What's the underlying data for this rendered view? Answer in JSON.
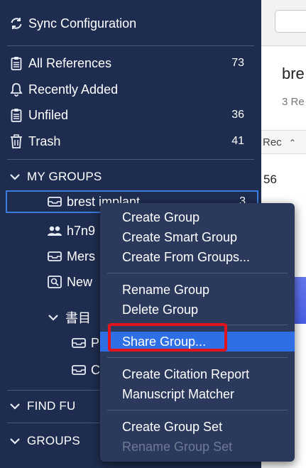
{
  "sidebar": {
    "sync": "Sync Configuration",
    "library": [
      {
        "label": "All References",
        "count": "73"
      },
      {
        "label": "Recently Added",
        "count": ""
      },
      {
        "label": "Unfiled",
        "count": "36"
      },
      {
        "label": "Trash",
        "count": "41"
      }
    ],
    "my_groups": "MY GROUPS",
    "groups": [
      {
        "label": "brest implant",
        "count": "3"
      },
      {
        "label": "h7n9",
        "count": ""
      },
      {
        "label": "Mers",
        "count": ""
      },
      {
        "label": "New",
        "count": ""
      }
    ],
    "group_set": "書目",
    "group_set_items": [
      "P",
      "C"
    ],
    "find_full_text": "FIND FU",
    "groups_section": "GROUPS"
  },
  "context_menu": {
    "items": [
      {
        "label": "Create Group",
        "enabled": true
      },
      {
        "label": "Create Smart Group",
        "enabled": true
      },
      {
        "label": "Create From Groups...",
        "enabled": true
      },
      {
        "label": "Rename Group",
        "enabled": true
      },
      {
        "label": "Delete Group",
        "enabled": true
      },
      {
        "label": "Share Group...",
        "enabled": true,
        "highlighted": true
      },
      {
        "label": "Create Citation Report",
        "enabled": true
      },
      {
        "label": "Manuscript Matcher",
        "enabled": true
      },
      {
        "label": "Create Group Set",
        "enabled": true
      },
      {
        "label": "Rename Group Set",
        "enabled": false
      }
    ]
  },
  "main": {
    "group_title": "bre",
    "group_subtitle": "3 Re",
    "column_header": "Rec",
    "first_cell": "56"
  },
  "colors": {
    "sidebar_bg": "#1e2d4f",
    "menu_bg": "#2b3a5c",
    "highlight": "#2f6fe6",
    "annotation_red": "#e0141c"
  }
}
